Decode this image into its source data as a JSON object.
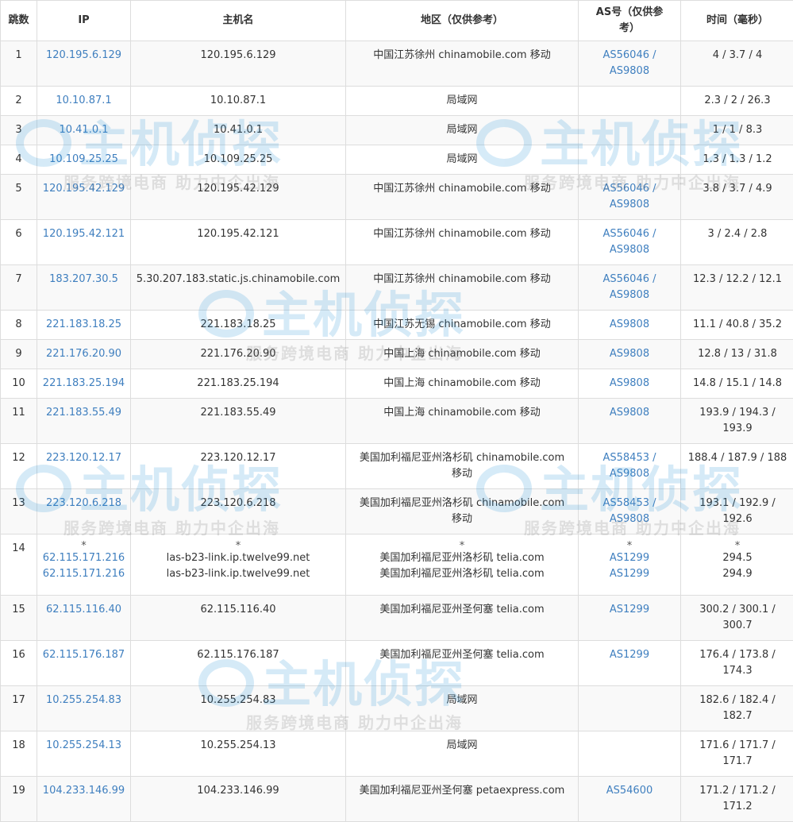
{
  "headers": {
    "hop": "跳数",
    "ip": "IP",
    "hostname": "主机名",
    "region": "地区（仅供参考）",
    "as": "AS号（仅供参考）",
    "time": "时间（毫秒）"
  },
  "watermark": {
    "brand": "主机侦探",
    "slogan": "服务跨境电商 助力中企出海"
  },
  "rows": [
    {
      "hop": "1",
      "ip": [
        "120.195.6.129"
      ],
      "host": [
        "120.195.6.129"
      ],
      "region": [
        "中国江苏徐州 chinamobile.com 移动"
      ],
      "as": [
        "AS56046 /",
        "AS9808"
      ],
      "time": [
        "4 / 3.7 / 4"
      ]
    },
    {
      "hop": "2",
      "ip": [
        "10.10.87.1"
      ],
      "host": [
        "10.10.87.1"
      ],
      "region": [
        "局域网"
      ],
      "as": [],
      "time": [
        "2.3 / 2 / 26.3"
      ]
    },
    {
      "hop": "3",
      "ip": [
        "10.41.0.1"
      ],
      "host": [
        "10.41.0.1"
      ],
      "region": [
        "局域网"
      ],
      "as": [],
      "time": [
        "1 / 1 / 8.3"
      ]
    },
    {
      "hop": "4",
      "ip": [
        "10.109.25.25"
      ],
      "host": [
        "10.109.25.25"
      ],
      "region": [
        "局域网"
      ],
      "as": [],
      "time": [
        "1.3 / 1.3 / 1.2"
      ]
    },
    {
      "hop": "5",
      "ip": [
        "120.195.42.129"
      ],
      "host": [
        "120.195.42.129"
      ],
      "region": [
        "中国江苏徐州 chinamobile.com 移动"
      ],
      "as": [
        "AS56046 /",
        "AS9808"
      ],
      "time": [
        "3.8 / 3.7 / 4.9"
      ]
    },
    {
      "hop": "6",
      "ip": [
        "120.195.42.121"
      ],
      "host": [
        "120.195.42.121"
      ],
      "region": [
        "中国江苏徐州 chinamobile.com 移动"
      ],
      "as": [
        "AS56046 /",
        "AS9808"
      ],
      "time": [
        "3 / 2.4 / 2.8"
      ]
    },
    {
      "hop": "7",
      "ip": [
        "183.207.30.5"
      ],
      "host": [
        "5.30.207.183.static.js.chinamobile.com"
      ],
      "region": [
        "中国江苏徐州 chinamobile.com 移动"
      ],
      "as": [
        "AS56046 /",
        "AS9808"
      ],
      "time": [
        "12.3 / 12.2 / 12.1"
      ]
    },
    {
      "hop": "8",
      "ip": [
        "221.183.18.25"
      ],
      "host": [
        "221.183.18.25"
      ],
      "region": [
        "中国江苏无锡 chinamobile.com 移动"
      ],
      "as": [
        "AS9808"
      ],
      "time": [
        "11.1 / 40.8 / 35.2"
      ]
    },
    {
      "hop": "9",
      "ip": [
        "221.176.20.90"
      ],
      "host": [
        "221.176.20.90"
      ],
      "region": [
        "中国上海 chinamobile.com 移动"
      ],
      "as": [
        "AS9808"
      ],
      "time": [
        "12.8 / 13 / 31.8"
      ]
    },
    {
      "hop": "10",
      "ip": [
        "221.183.25.194"
      ],
      "host": [
        "221.183.25.194"
      ],
      "region": [
        "中国上海 chinamobile.com 移动"
      ],
      "as": [
        "AS9808"
      ],
      "time": [
        "14.8 / 15.1 / 14.8"
      ]
    },
    {
      "hop": "11",
      "ip": [
        "221.183.55.49"
      ],
      "host": [
        "221.183.55.49"
      ],
      "region": [
        "中国上海 chinamobile.com 移动"
      ],
      "as": [
        "AS9808"
      ],
      "time": [
        "193.9 / 194.3 /",
        "193.9"
      ]
    },
    {
      "hop": "12",
      "ip": [
        "223.120.12.17"
      ],
      "host": [
        "223.120.12.17"
      ],
      "region": [
        "美国加利福尼亚州洛杉矶 chinamobile.com",
        "移动"
      ],
      "as": [
        "AS58453 /",
        "AS9808"
      ],
      "time": [
        "188.4 / 187.9 / 188"
      ]
    },
    {
      "hop": "13",
      "ip": [
        "223.120.6.218"
      ],
      "host": [
        "223.120.6.218"
      ],
      "region": [
        "美国加利福尼亚州洛杉矶 chinamobile.com",
        "移动"
      ],
      "as": [
        "AS58453 /",
        "AS9808"
      ],
      "time": [
        "193.1 / 192.9 /",
        "192.6"
      ]
    },
    {
      "hop": "14",
      "star": "*",
      "ip": [
        "62.115.171.216",
        "62.115.171.216"
      ],
      "host": [
        "las-b23-link.ip.twelve99.net",
        "las-b23-link.ip.twelve99.net"
      ],
      "region": [
        "美国加利福尼亚州洛杉矶 telia.com",
        "美国加利福尼亚州洛杉矶 telia.com"
      ],
      "as": [
        "AS1299",
        "AS1299"
      ],
      "time": [
        "294.5",
        "294.9"
      ]
    },
    {
      "hop": "15",
      "ip": [
        "62.115.116.40"
      ],
      "host": [
        "62.115.116.40"
      ],
      "region": [
        "美国加利福尼亚州圣何塞 telia.com"
      ],
      "as": [
        "AS1299"
      ],
      "time": [
        "300.2 / 300.1 /",
        "300.7"
      ]
    },
    {
      "hop": "16",
      "ip": [
        "62.115.176.187"
      ],
      "host": [
        "62.115.176.187"
      ],
      "region": [
        "美国加利福尼亚州圣何塞 telia.com"
      ],
      "as": [
        "AS1299"
      ],
      "time": [
        "176.4 / 173.8 /",
        "174.3"
      ]
    },
    {
      "hop": "17",
      "ip": [
        "10.255.254.83"
      ],
      "host": [
        "10.255.254.83"
      ],
      "region": [
        "局域网"
      ],
      "as": [],
      "time": [
        "182.6 / 182.4 /",
        "182.7"
      ]
    },
    {
      "hop": "18",
      "ip": [
        "10.255.254.13"
      ],
      "host": [
        "10.255.254.13"
      ],
      "region": [
        "局域网"
      ],
      "as": [],
      "time": [
        "171.6 / 171.7 /",
        "171.7"
      ]
    },
    {
      "hop": "19",
      "ip": [
        "104.233.146.99"
      ],
      "host": [
        "104.233.146.99"
      ],
      "region": [
        "美国加利福尼亚州圣何塞 petaexpress.com"
      ],
      "as": [
        "AS54600"
      ],
      "time": [
        "171.2 / 171.2 /",
        "171.2"
      ]
    }
  ],
  "colors": {
    "link": "#3f7fbf",
    "border": "#dddddd",
    "stripe": "#f9f9f9",
    "watermark": "#1e8fd6"
  }
}
